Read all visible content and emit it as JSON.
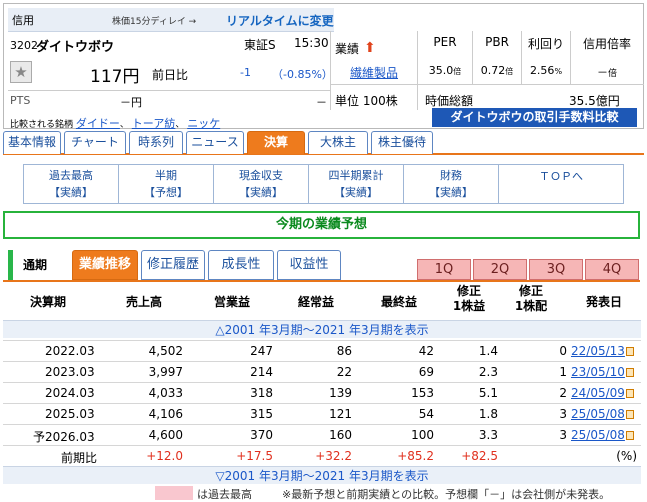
{
  "header": {
    "shinyo": "信用",
    "delay_note": "株価15分ディレイ →",
    "realtime_link": "リアルタイムに変更",
    "code": "3202",
    "name": "ダイトウボウ",
    "market": "東証S",
    "time": "15:30",
    "price": "117円",
    "zenjitsu_label": "前日比",
    "change": "-1",
    "change_pct": "（-0.85%）",
    "pts_label": "PTS",
    "pts_value": "－円",
    "pts_dash": "－",
    "compare_label": "比較される銘柄",
    "compare": [
      "ダイドー",
      "トーア紡",
      "ニッケ"
    ],
    "gyoseki_label": "業績",
    "sector": "繊維製品",
    "tani": "単位 100株",
    "ratios": [
      {
        "label": "PER",
        "value": "35.0",
        "unit": "倍"
      },
      {
        "label": "PBR",
        "value": "0.72",
        "unit": "倍"
      },
      {
        "label": "利回り",
        "value": "2.56",
        "unit": "%"
      },
      {
        "label": "信用倍率",
        "value": "－",
        "unit": "倍"
      }
    ],
    "jika_label": "時価総額",
    "jika_value": "35.5億円",
    "fee_button": "ダイトウボウの取引手数料比較"
  },
  "tabs": [
    "基本情報",
    "チャート",
    "時系列",
    "ニュース",
    "決算",
    "大株主",
    "株主優待"
  ],
  "active_tab": "決算",
  "subnav": [
    {
      "l1": "過去最高",
      "l2": "【実績】"
    },
    {
      "l1": "半期",
      "l2": "【予想】"
    },
    {
      "l1": "現金収支",
      "l2": "【実績】"
    },
    {
      "l1": "四半期累計",
      "l2": "【実績】"
    },
    {
      "l1": "財務",
      "l2": "【実績】"
    },
    {
      "l1": "ＴＯＰへ",
      "l2": ""
    }
  ],
  "banner": "今期の業績予想",
  "period_label": "通期",
  "period_tabs": [
    "業績推移",
    "修正履歴",
    "成長性",
    "収益性"
  ],
  "quarter_buttons": [
    "1Q",
    "2Q",
    "3Q",
    "4Q"
  ],
  "table": {
    "headers": [
      "決算期",
      "売上高",
      "営業益",
      "経常益",
      "最終益",
      "修正\n1株益",
      "修正\n1株配",
      "発表日"
    ],
    "show_link_top": "△2001 年3月期～2021 年3月期を表示",
    "rows": [
      {
        "prefix": "",
        "period": "2022.03",
        "sales": "4,502",
        "op": "247",
        "ord": "86",
        "net": "42",
        "eps": "1.4",
        "div": "0",
        "date": "22/05/13"
      },
      {
        "prefix": "",
        "period": "2023.03",
        "sales": "3,997",
        "op": "214",
        "ord": "22",
        "net": "69",
        "eps": "2.3",
        "div": "1",
        "date": "23/05/10"
      },
      {
        "prefix": "",
        "period": "2024.03",
        "sales": "4,033",
        "op": "318",
        "ord": "139",
        "net": "153",
        "eps": "5.1",
        "div": "2",
        "date": "24/05/09"
      },
      {
        "prefix": "",
        "period": "2025.03",
        "sales": "4,106",
        "op": "315",
        "ord": "121",
        "net": "54",
        "eps": "1.8",
        "div": "3",
        "date": "25/05/08"
      },
      {
        "prefix": "予",
        "period": "2026.03",
        "sales": "4,600",
        "op": "370",
        "ord": "160",
        "net": "100",
        "eps": "3.3",
        "div": "3",
        "date": "25/05/08"
      }
    ],
    "yoy": {
      "label": "前期比",
      "sales": "+12.0",
      "op": "+17.5",
      "ord": "+32.2",
      "net": "+85.2",
      "eps": "+82.5",
      "unit": "(%)"
    },
    "show_link_bottom": "▽2001 年3月期～2021 年3月期を表示"
  },
  "legend_text": "は過去最高",
  "note": "※最新予想と前期実績との比較。予想欄「－」は会社側が未発表。"
}
